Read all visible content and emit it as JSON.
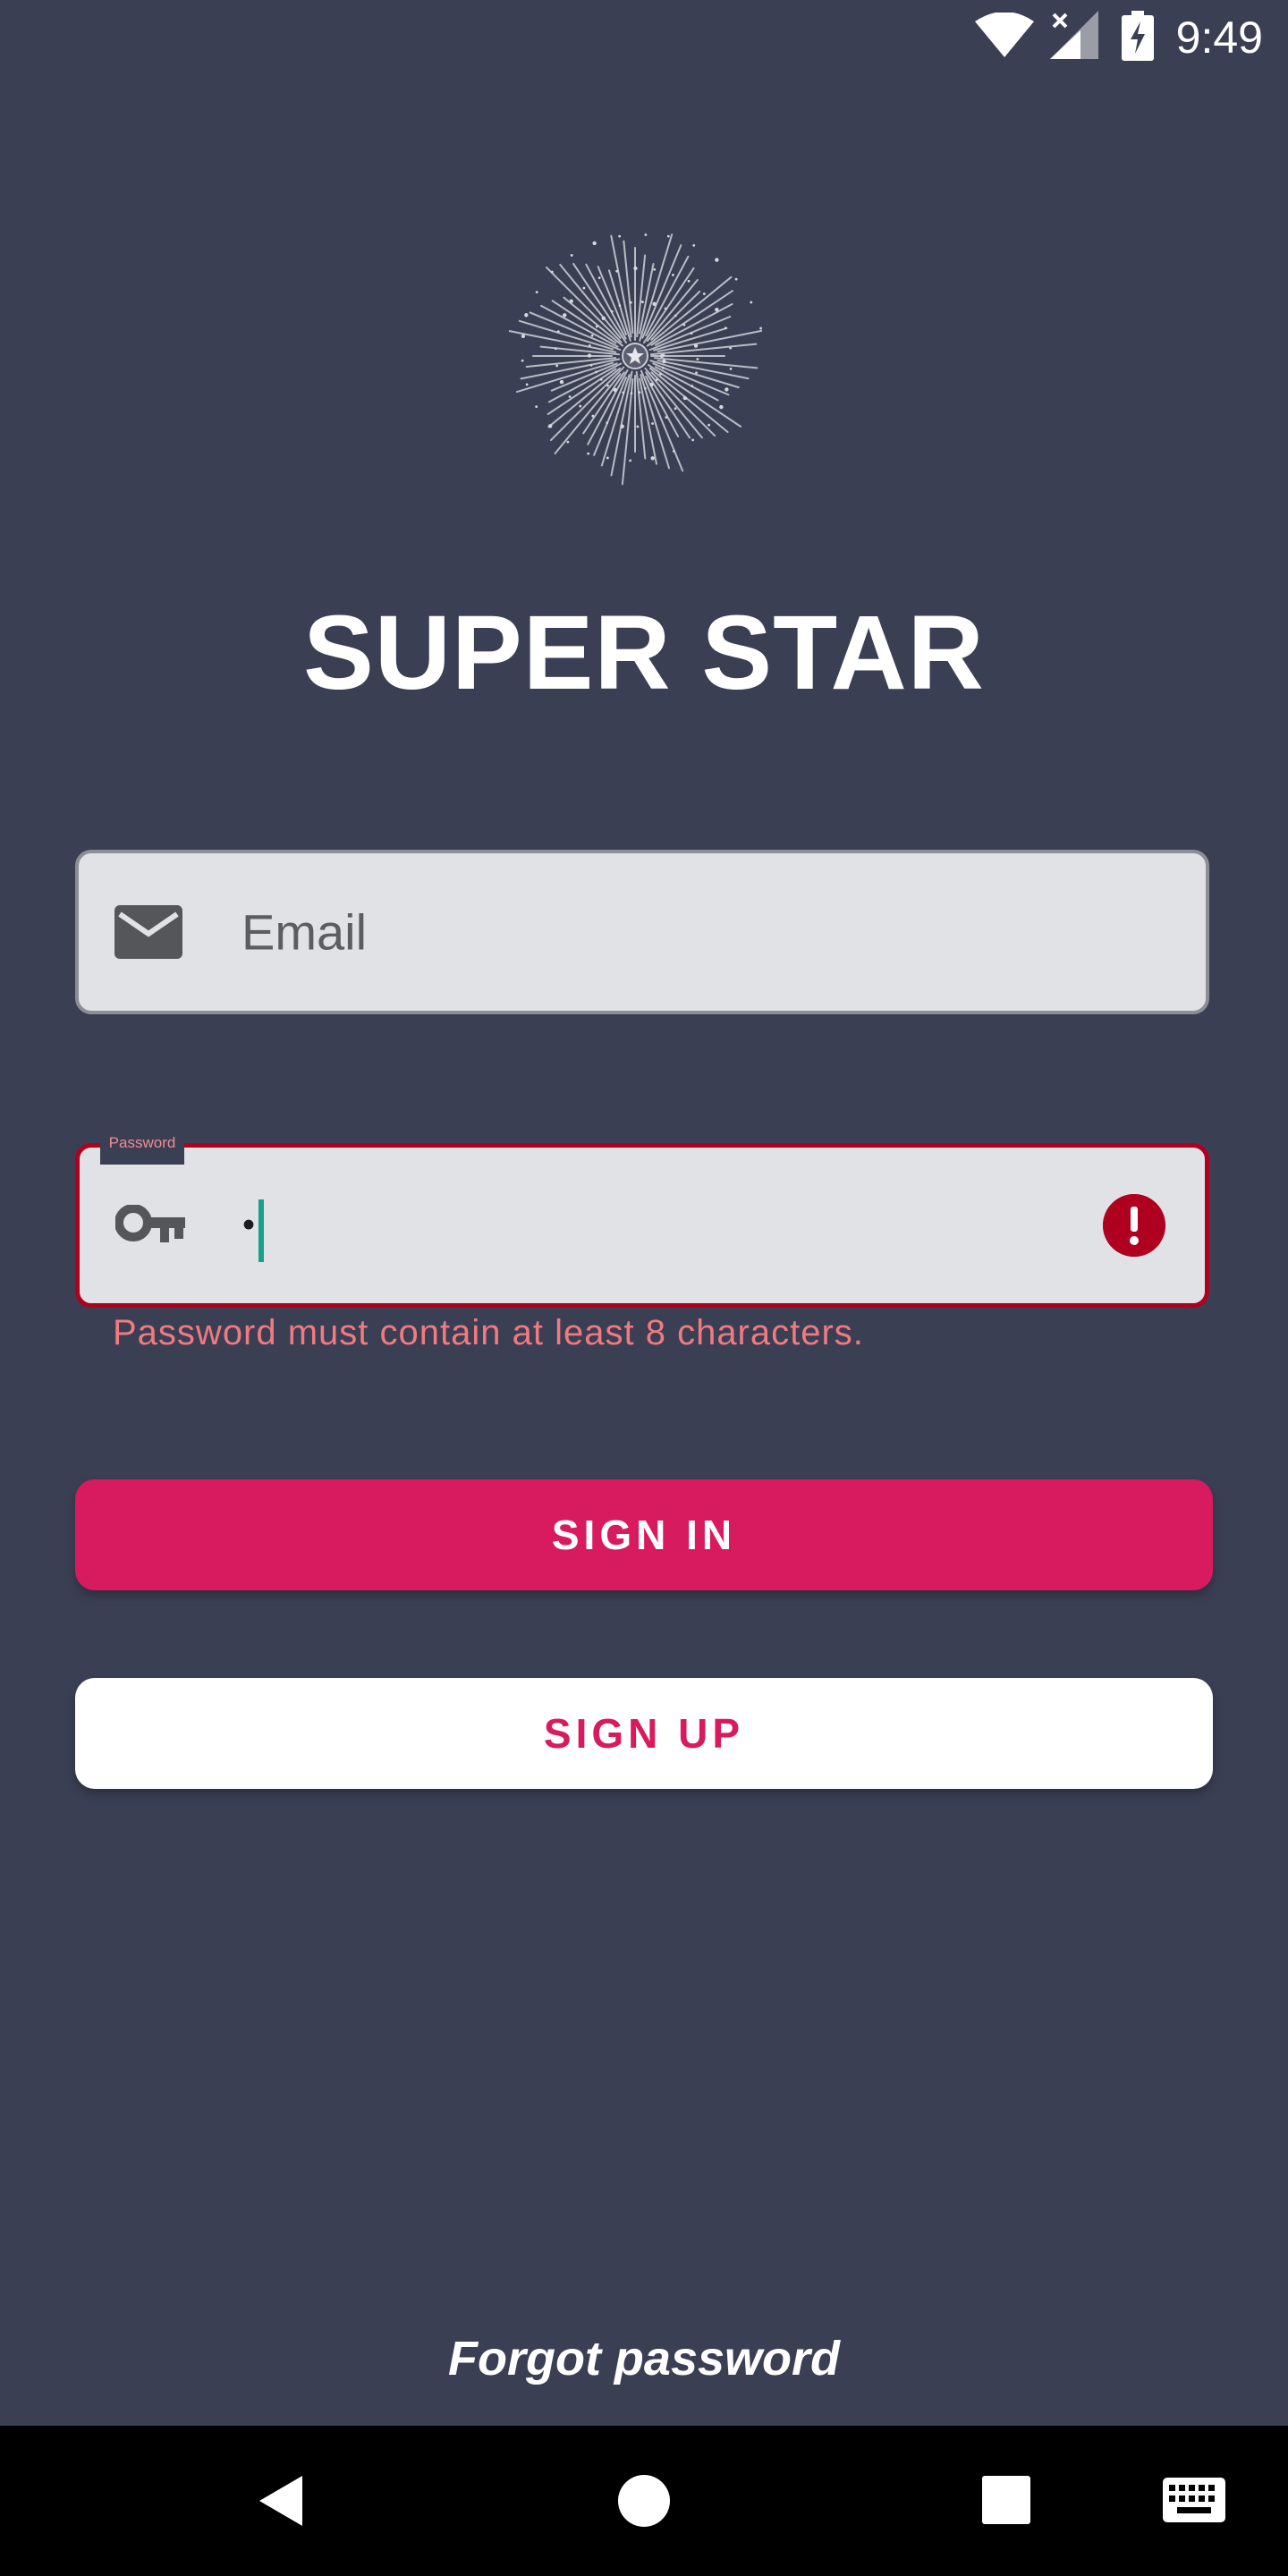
{
  "status_bar": {
    "time": "9:49",
    "icons": [
      "wifi-icon",
      "cell-signal-icon",
      "battery-charging-icon"
    ]
  },
  "app": {
    "title": "SUPER STAR",
    "logo": "starburst-logo"
  },
  "form": {
    "email": {
      "placeholder": "Email",
      "value": "",
      "icon": "email-icon"
    },
    "password": {
      "label": "Password",
      "value": "•",
      "icon": "key-icon",
      "error": "Password must contain at least 8 characters.",
      "error_icon": "error-icon"
    }
  },
  "buttons": {
    "sign_in": "SIGN IN",
    "sign_up": "SIGN UP"
  },
  "links": {
    "forgot_password": "Forgot password"
  },
  "navigation": {
    "icons": [
      "back-icon",
      "home-icon",
      "recents-icon",
      "keyboard-icon"
    ]
  },
  "colors": {
    "background": "#3b3f53",
    "accent": "#d81b5e",
    "error": "#b00020",
    "error_text": "#f07a80",
    "field_bg": "#e1e2e5"
  }
}
